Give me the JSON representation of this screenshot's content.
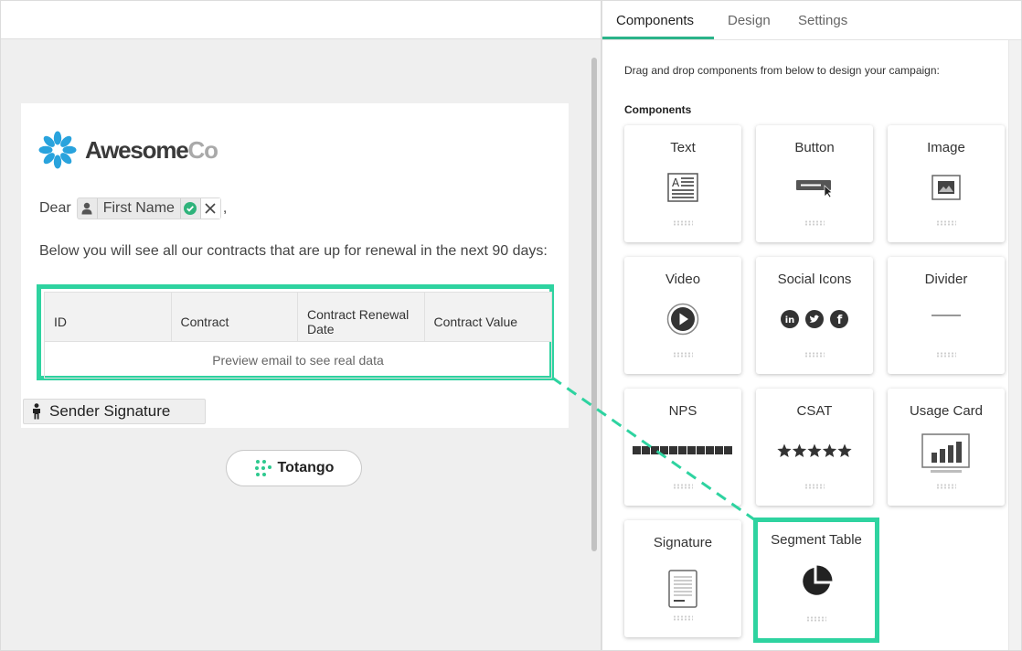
{
  "tabs": [
    {
      "label": "Components",
      "active": true
    },
    {
      "label": "Design",
      "active": false
    },
    {
      "label": "Settings",
      "active": false
    }
  ],
  "panel": {
    "instructions": "Drag and drop components from below to design your campaign:",
    "section_title": "Components",
    "components": [
      {
        "label": "Text",
        "icon": "text-block-icon"
      },
      {
        "label": "Button",
        "icon": "button-icon"
      },
      {
        "label": "Image",
        "icon": "image-icon"
      },
      {
        "label": "Video",
        "icon": "play-icon"
      },
      {
        "label": "Social Icons",
        "icon": "social-icons-icon"
      },
      {
        "label": "Divider",
        "icon": "divider-line-icon"
      },
      {
        "label": "NPS",
        "icon": "nps-scale-icon"
      },
      {
        "label": "CSAT",
        "icon": "stars-icon"
      },
      {
        "label": "Usage Card",
        "icon": "bar-chart-icon"
      },
      {
        "label": "Signature",
        "icon": "document-icon"
      },
      {
        "label": "Segment Table",
        "icon": "pie-chart-icon",
        "highlighted": true
      }
    ],
    "csat_stars": 5,
    "nps_boxes": 11
  },
  "email": {
    "logo": {
      "part1": "Awesome",
      "part2": "Co"
    },
    "greeting": "Dear",
    "merge_field": "First Name",
    "comma": ",",
    "intro": "Below you will see all our contracts that are up for renewal in the next 90 days:",
    "table": {
      "headers": [
        "ID",
        "Contract",
        "Contract Renewal Date",
        "Contract Value"
      ],
      "placeholder": "Preview email to see real data"
    },
    "signature": "Sender Signature",
    "footer_brand": "Totango"
  },
  "colors": {
    "highlight": "#2ed3a0",
    "tab_underline": "#2ab389",
    "logo_blue": "#29a3dd",
    "check_green": "#2fb37b"
  }
}
